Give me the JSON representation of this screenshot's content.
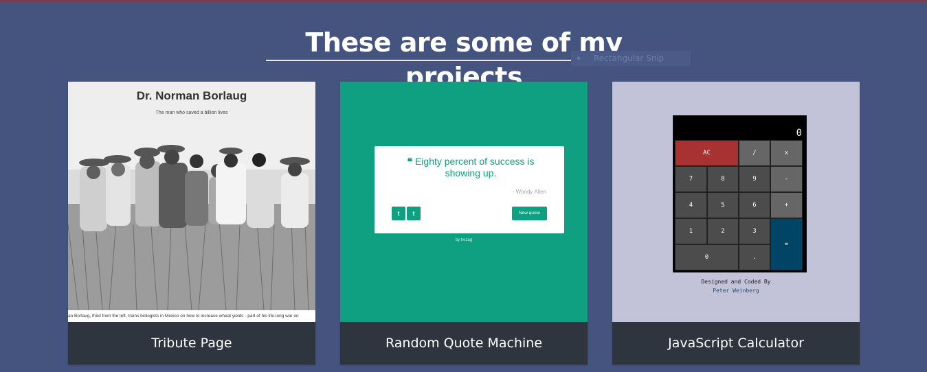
{
  "section": {
    "title": "These are some of my projects"
  },
  "snip": {
    "label": "Rectangular Snip"
  },
  "projects": [
    {
      "title": "Tribute Page",
      "preview": {
        "name": "Dr. Norman Borlaug",
        "subtitle": "The man who saved a billion lives",
        "caption": "an Borlaug, third from the left, trains biologists in Mexico on how to increase wheat yields - part of his life-long war on"
      }
    },
    {
      "title": "Random Quote Machine",
      "preview": {
        "quote": "Eighty percent of success is showing up.",
        "author": "- Woody Allen",
        "twitter": "t",
        "tumblr": "t",
        "new_quote": "New quote",
        "by": "by hezag"
      }
    },
    {
      "title": "JavaScript Calculator",
      "preview": {
        "display": "0",
        "keys": [
          "AC",
          "/",
          "x",
          "7",
          "8",
          "9",
          "-",
          "4",
          "5",
          "6",
          "+",
          "1",
          "2",
          "3",
          "=",
          "0",
          "."
        ],
        "credit": "Designed and Coded By",
        "author": "Peter Weinberg"
      }
    }
  ],
  "colors": {
    "background": "#44547e",
    "card_footer": "#2f353f",
    "quote_green": "#0ea080",
    "calc_clear": "#a83232",
    "calc_equals": "#004466"
  }
}
